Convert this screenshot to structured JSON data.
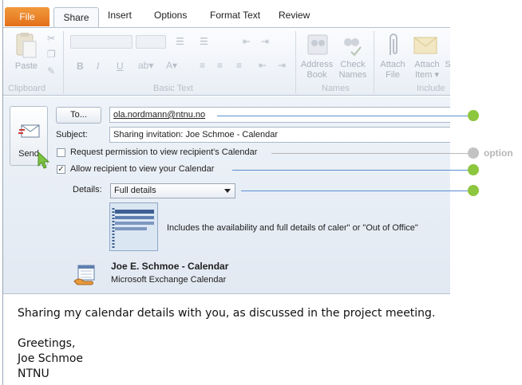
{
  "ribbon": {
    "tabs": {
      "file": "File",
      "share": "Share",
      "insert": "Insert",
      "options": "Options",
      "format_text": "Format Text",
      "review": "Review"
    },
    "groups": {
      "clipboard": "Clipboard",
      "basic_text": "Basic Text",
      "names": "Names",
      "include": "Include"
    },
    "buttons": {
      "paste": "Paste",
      "address_book_1": "Address",
      "address_book_2": "Book",
      "check_names_1": "Check",
      "check_names_2": "Names",
      "attach_file_1": "Attach",
      "attach_file_2": "File",
      "attach_item_1": "Attach",
      "attach_item_2": "Item ▾",
      "signature_partial": "S"
    }
  },
  "form": {
    "send_label": "Send",
    "to_label": "To...",
    "to_value": "ola.nordmann@ntnu.no",
    "subject_label": "Subject:",
    "subject_value": "Sharing invitation: Joe Schmoe - Calendar",
    "request_permission_label": "Request permission to view recipient's Calendar",
    "request_permission_checked": false,
    "allow_recipient_label": "Allow recipient to view your Calendar",
    "allow_recipient_checked": true,
    "details_label": "Details:",
    "details_value": "Full details",
    "details_description": "Includes the availability and full details of caler\" or \"Out of Office\"",
    "calendar_owner": "Joe E. Schmoe - Calendar",
    "calendar_source": "Microsoft Exchange Calendar"
  },
  "message_body": {
    "line1": "Sharing my calendar details with you, as discussed in the project meeting.",
    "line2": "Greetings,",
    "line3": "Joe Schmoe",
    "line4": "NTNU"
  },
  "annotations": {
    "option_label": "option",
    "colors": {
      "required": "#8dc63f",
      "optional": "#c3c3c3",
      "line": "#5a8fd0"
    }
  }
}
